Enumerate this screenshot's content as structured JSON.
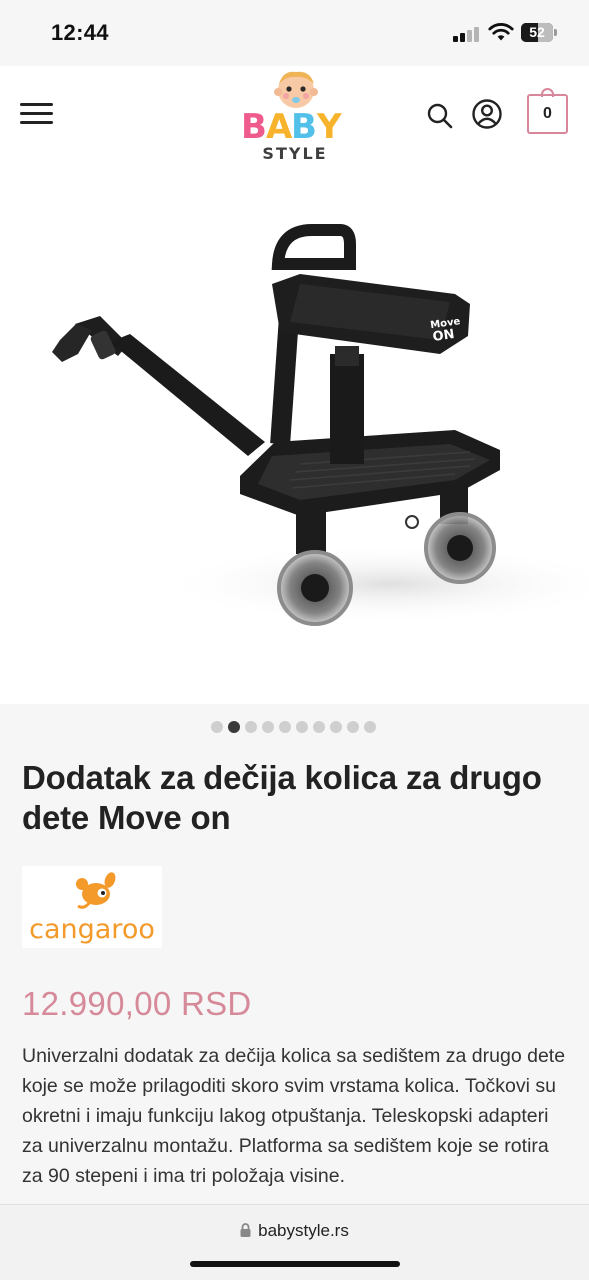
{
  "status_bar": {
    "time": "12:44",
    "battery_level": "52",
    "icons": [
      "signal-icon",
      "wifi-icon",
      "battery-icon"
    ]
  },
  "header": {
    "logo_text_top": "BABY",
    "logo_text_bottom": "STYLE",
    "cart_count": "0",
    "icons": [
      "menu-icon",
      "search-icon",
      "account-icon",
      "cart-icon"
    ],
    "colors": {
      "accent": "#d8879a"
    }
  },
  "product": {
    "gallery": {
      "total_images": 10,
      "active_index": 1
    },
    "image_badge": "Move ON",
    "title": "Dodatak za dečija kolica za drugo dete Move on",
    "brand": {
      "name": "cangaroo"
    },
    "price": "12.990,00 RSD",
    "description": "Univerzalni dodatak za dečija kolica sa sedištem za drugo dete koje se može prilagoditi skoro svim vrstama kolica. Točkovi su okretni i imaju funkciju lakog otpuštanja. Teleskopski adapteri za univerzalnu montažu. Platforma sa sedištem koje se rotira za 90 stepeni i ima tri položaja visine."
  },
  "browser": {
    "url": "babystyle.rs"
  },
  "colors": {
    "price": "#d68a99",
    "brand_orange": "#f39a2b",
    "background": "#f6f6f6"
  }
}
